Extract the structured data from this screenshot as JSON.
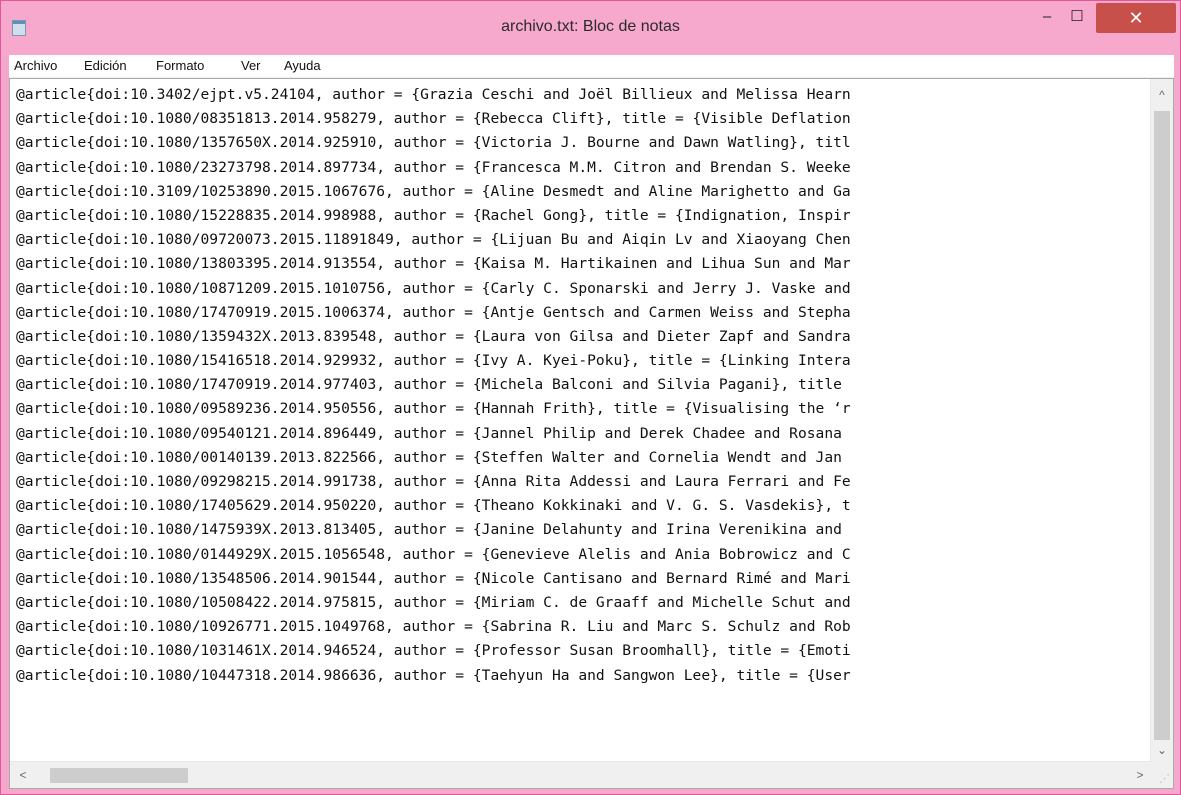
{
  "window": {
    "title": "archivo.txt: Bloc de notas",
    "controls": {
      "minimize": "–",
      "maximize": "☐",
      "close": "✕"
    },
    "accent_color": "#f7a8cd",
    "close_color": "#c7504a"
  },
  "menu": {
    "items": [
      "Archivo",
      "Edición",
      "Formato",
      "Ver",
      "Ayuda"
    ]
  },
  "editor": {
    "lines": [
      "@article{doi:10.3402/ejpt.v5.24104, author = {Grazia Ceschi and Joël Billieux and Melissa Hearn",
      "@article{doi:10.1080/08351813.2014.958279, author = {Rebecca Clift}, title = {Visible Deflation",
      "@article{doi:10.1080/1357650X.2014.925910, author = {Victoria J. Bourne and Dawn Watling}, titl",
      "@article{doi:10.1080/23273798.2014.897734, author = {Francesca M.M. Citron and Brendan S. Weeke",
      "@article{doi:10.3109/10253890.2015.1067676, author = {Aline Desmedt and Aline Marighetto and Ga",
      "@article{doi:10.1080/15228835.2014.998988, author = {Rachel Gong}, title = {Indignation, Inspir",
      "@article{doi:10.1080/09720073.2015.11891849, author = {Lijuan Bu and Aiqin Lv and Xiaoyang Chen",
      "@article{doi:10.1080/13803395.2014.913554, author = {Kaisa M. Hartikainen and Lihua Sun and Mar",
      "@article{doi:10.1080/10871209.2015.1010756, author = {Carly C. Sponarski and Jerry J. Vaske and",
      "@article{doi:10.1080/17470919.2015.1006374, author = {Antje Gentsch and Carmen Weiss and Stepha",
      "@article{doi:10.1080/1359432X.2013.839548, author = {Laura von Gilsa and Dieter Zapf and Sandra",
      "@article{doi:10.1080/15416518.2014.929932, author = {Ivy A. Kyei-Poku}, title = {Linking Intera",
      "@article{doi:10.1080/17470919.2014.977403, author = {Michela Balconi and Silvia Pagani}, title",
      "@article{doi:10.1080/09589236.2014.950556, author = {Hannah Frith}, title = {Visualising the ‘r",
      "@article{doi:10.1080/09540121.2014.896449, author = {Jannel Philip and Derek Chadee and Rosana",
      "@article{doi:10.1080/00140139.2013.822566, author = {Steffen Walter and Cornelia Wendt and Jan",
      "@article{doi:10.1080/09298215.2014.991738, author = {Anna Rita Addessi and Laura Ferrari and Fe",
      "@article{doi:10.1080/17405629.2014.950220, author = {Theano Kokkinaki and V. G. S. Vasdekis}, t",
      "@article{doi:10.1080/1475939X.2013.813405, author = {Janine Delahunty and Irina Verenikina and",
      "@article{doi:10.1080/0144929X.2015.1056548, author = {Genevieve Alelis and Ania Bobrowicz and C",
      "@article{doi:10.1080/13548506.2014.901544, author = {Nicole Cantisano and Bernard Rimé and Mari",
      "@article{doi:10.1080/10508422.2014.975815, author = {Miriam C. de Graaff and Michelle Schut and",
      "@article{doi:10.1080/10926771.2015.1049768, author = {Sabrina R. Liu and Marc S. Schulz and Rob",
      "@article{doi:10.1080/1031461X.2014.946524, author = {Professor Susan Broomhall}, title = {Emoti",
      "@article{doi:10.1080/10447318.2014.986636, author = {Taehyun Ha and Sangwon Lee}, title = {User"
    ]
  },
  "scrollbars": {
    "up_arrow": "^",
    "down_arrow": "⌄",
    "left_arrow": "<",
    "right_arrow": ">"
  }
}
